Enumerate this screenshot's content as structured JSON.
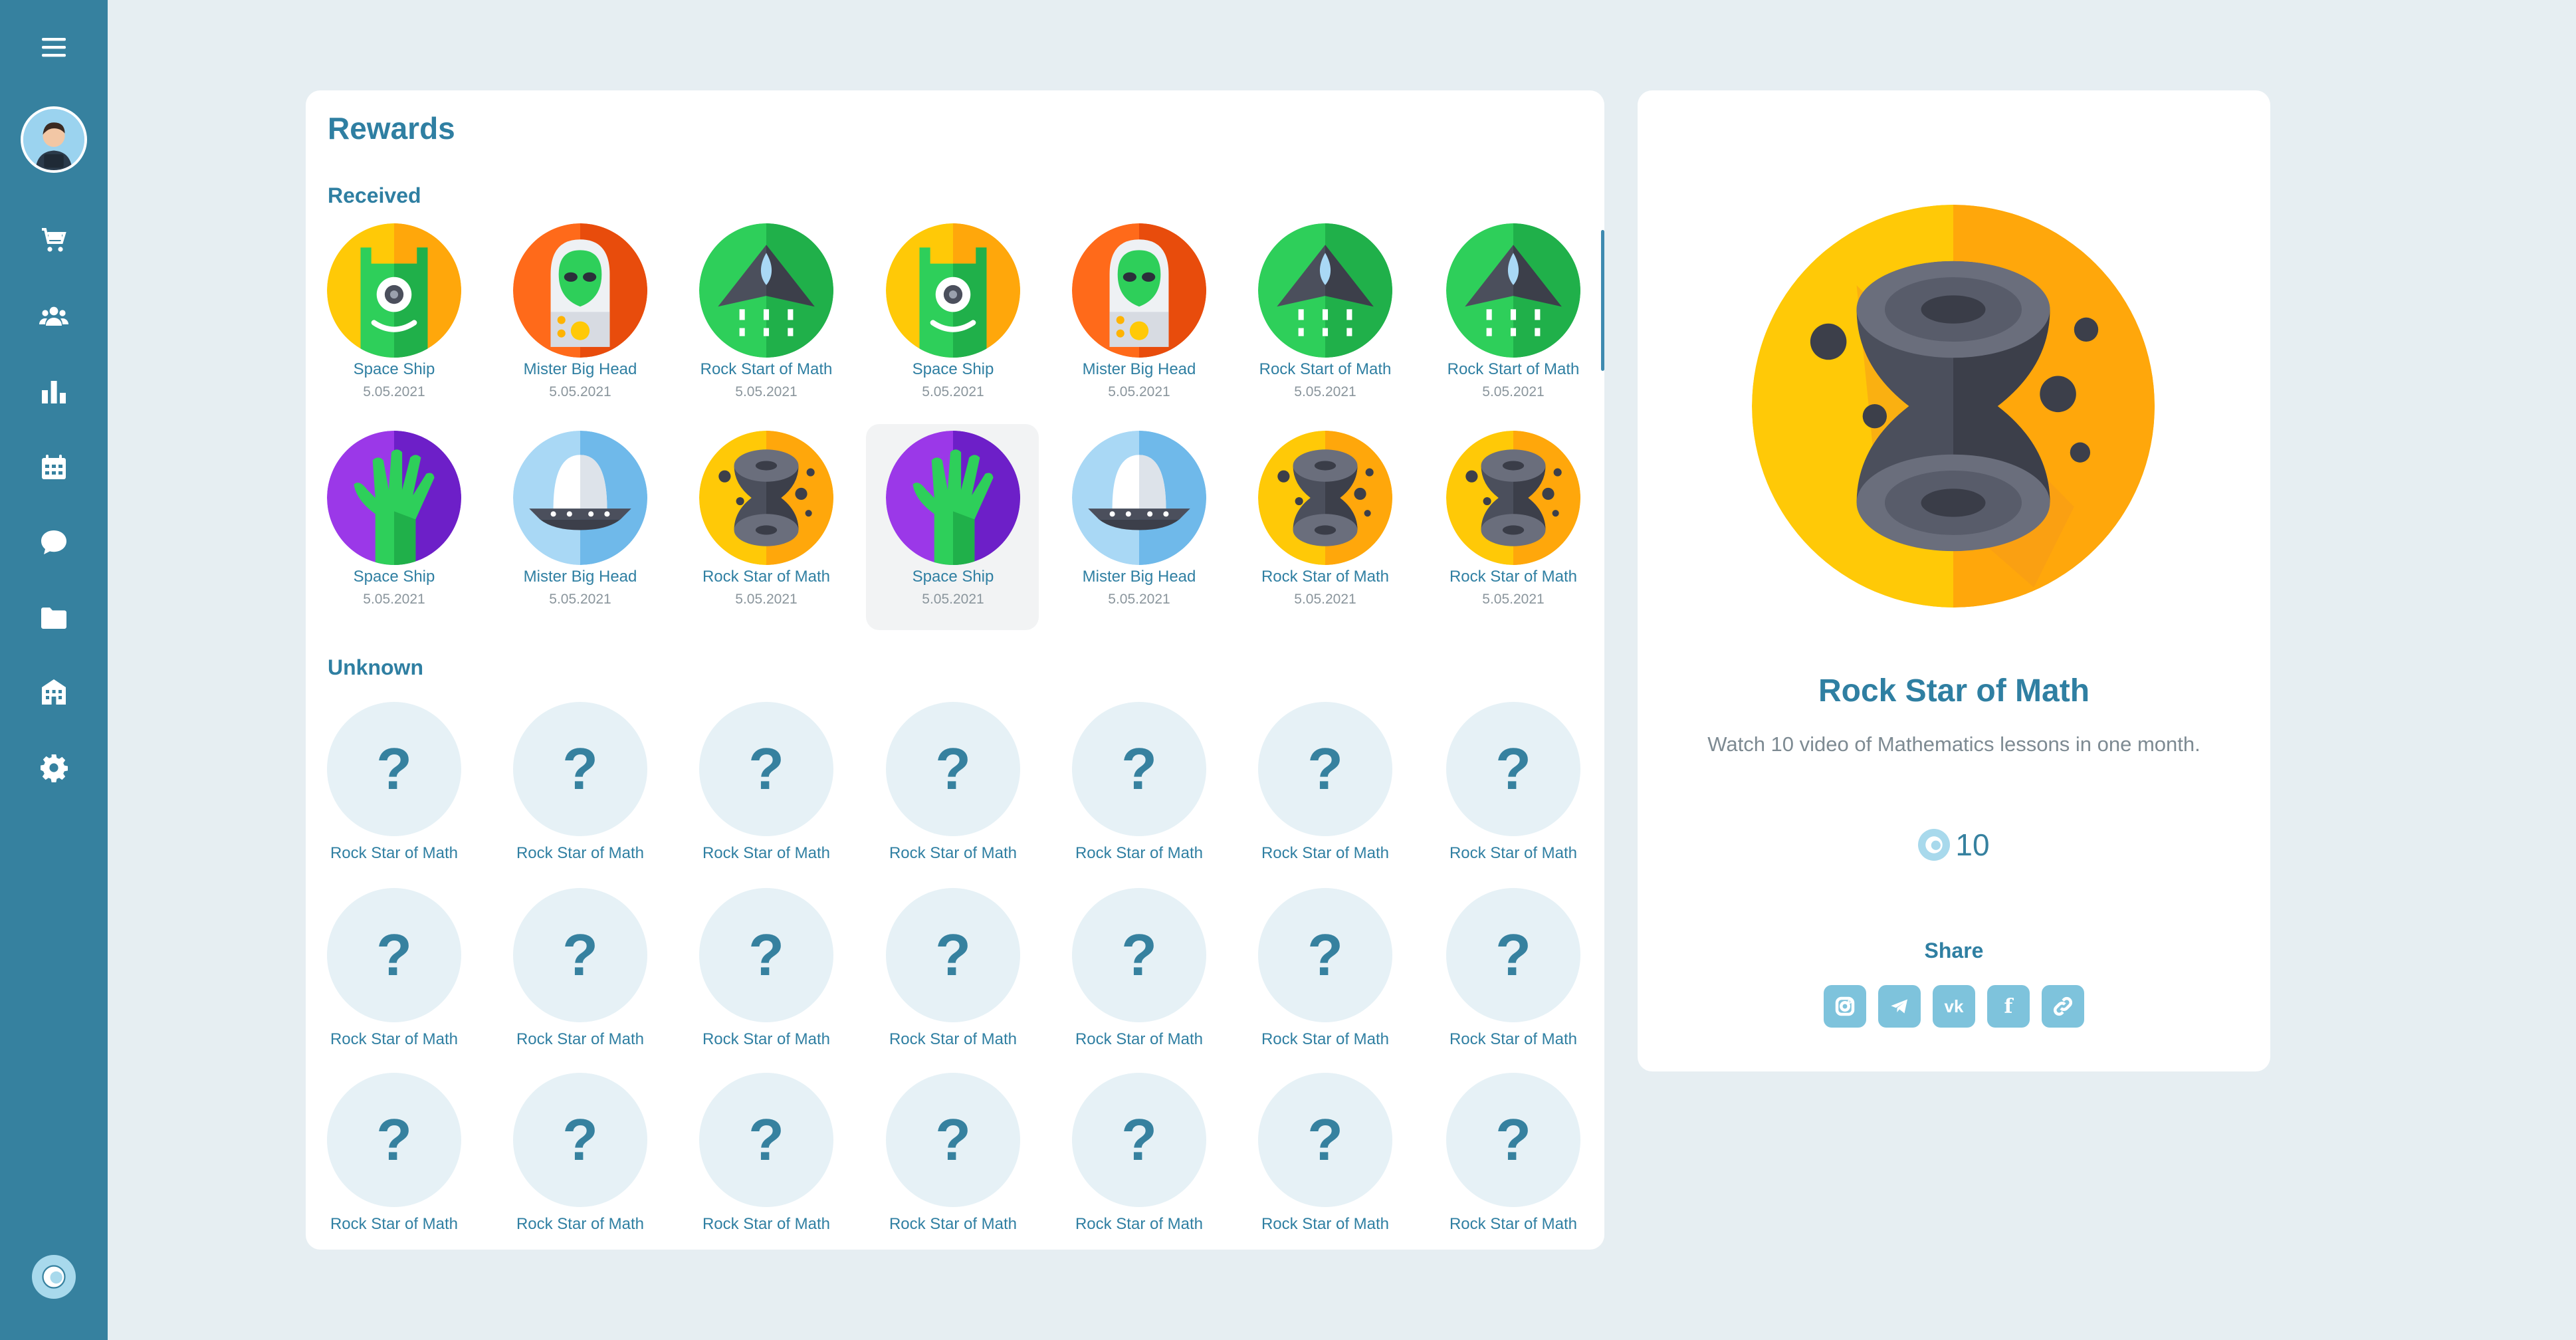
{
  "sidebar": {
    "icons": [
      "menu-icon",
      "avatar",
      "cart-icon",
      "users-icon",
      "chart-icon",
      "calendar-icon",
      "chat-icon",
      "folder-icon",
      "building-icon",
      "gear-icon",
      "logo-icon"
    ]
  },
  "rewards": {
    "title": "Rewards",
    "received_label": "Received",
    "unknown_label": "Unknown",
    "received": [
      {
        "name": "Space Ship",
        "date": "5.05.2021",
        "art": "green-monster"
      },
      {
        "name": "Mister Big Head",
        "date": "5.05.2021",
        "art": "alien"
      },
      {
        "name": "Rock Start of Math",
        "date": "5.05.2021",
        "art": "rocket"
      },
      {
        "name": "Space Ship",
        "date": "5.05.2021",
        "art": "green-monster"
      },
      {
        "name": "Mister Big Head",
        "date": "5.05.2021",
        "art": "alien"
      },
      {
        "name": "Rock Start of Math",
        "date": "5.05.2021",
        "art": "rocket"
      },
      {
        "name": "Rock Start of Math",
        "date": "5.05.2021",
        "art": "rocket"
      },
      {
        "name": "Space Ship",
        "date": "5.05.2021",
        "art": "hand"
      },
      {
        "name": "Mister Big Head",
        "date": "5.05.2021",
        "art": "ufo"
      },
      {
        "name": "Rock Star of Math",
        "date": "5.05.2021",
        "art": "hourglass"
      },
      {
        "name": "Space Ship",
        "date": "5.05.2021",
        "art": "hand"
      },
      {
        "name": "Mister Big Head",
        "date": "5.05.2021",
        "art": "ufo"
      },
      {
        "name": "Rock Star of Math",
        "date": "5.05.2021",
        "art": "hourglass"
      },
      {
        "name": "Rock Star of Math",
        "date": "5.05.2021",
        "art": "hourglass"
      }
    ],
    "unknown": [
      "Rock Star of Math",
      "Rock Star of Math",
      "Rock Star of Math",
      "Rock Star of Math",
      "Rock Star of Math",
      "Rock Star of Math",
      "Rock Star of Math",
      "Rock Star of Math",
      "Rock Star of Math",
      "Rock Star of Math",
      "Rock Star of Math",
      "Rock Star of Math",
      "Rock Star of Math",
      "Rock Star of Math",
      "Rock Star of Math",
      "Rock Star of Math",
      "Rock Star of Math",
      "Rock Star of Math",
      "Rock Star of Math",
      "Rock Star of Math",
      "Rock Star of Math"
    ],
    "unknown_mark": "?"
  },
  "detail": {
    "title": "Rock Star of Math",
    "description": "Watch 10 video of Mathematics lessons in one month.",
    "coins": "10",
    "share_label": "Share",
    "share_icons": [
      "instagram-icon",
      "telegram-icon",
      "vk-icon",
      "facebook-icon",
      "link-icon"
    ],
    "share_glyphs": {
      "vk": "vk",
      "facebook": "f"
    }
  },
  "colors": {
    "sidebar": "#36819f",
    "accent": "#2f7fa2",
    "background": "#e6eef2"
  }
}
